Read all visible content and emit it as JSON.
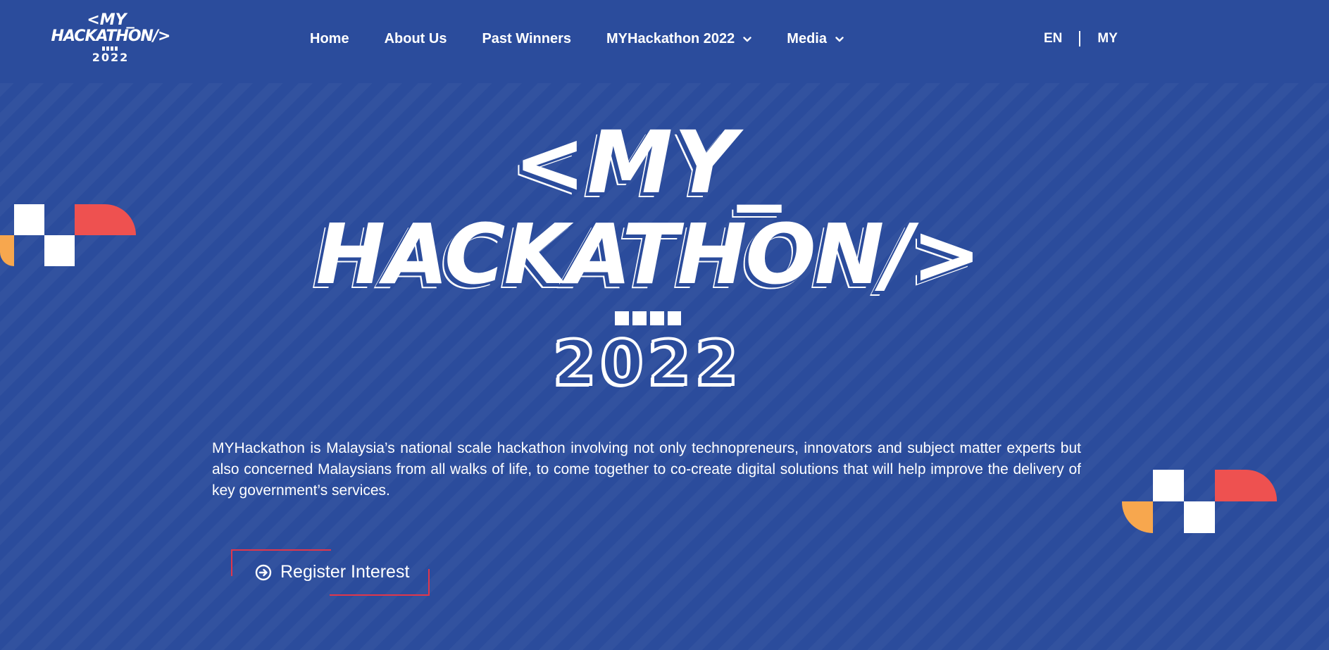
{
  "header": {
    "logo": {
      "line1": "<MY_",
      "line2": "HACKATHON/>",
      "line3": "2022"
    },
    "nav": [
      {
        "label": "Home",
        "has_dropdown": false
      },
      {
        "label": "About Us",
        "has_dropdown": false
      },
      {
        "label": "Past Winners",
        "has_dropdown": false
      },
      {
        "label": "MYHackathon 2022",
        "has_dropdown": true
      },
      {
        "label": "Media",
        "has_dropdown": true
      }
    ],
    "languages": [
      "EN",
      "MY"
    ]
  },
  "hero": {
    "title_line1": "<MY_",
    "title_line2": "HACKATHON/>",
    "title_year": "2022",
    "description": "MYHackathon is Malaysia’s national scale hackathon involving not only technopreneurs, innovators and subject matter experts but also concerned Malaysians from all walks of life, to come together to co-create digital solutions that will help improve the delivery of key government’s services.",
    "cta_label": "Register Interest",
    "cta_icon": "arrow-right-circle-icon"
  },
  "colors": {
    "background": "#2b4c9c",
    "accent_red": "#ee5150",
    "accent_orange": "#f7a74e",
    "button_border": "#e2364a",
    "text": "#ffffff"
  }
}
